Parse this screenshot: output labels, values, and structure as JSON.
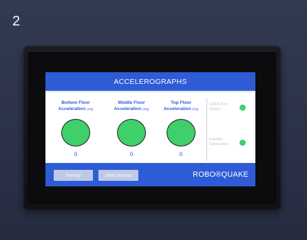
{
  "photo_label": "2",
  "header": {
    "title": "ACCELEROGRAPHS"
  },
  "sensors": [
    {
      "label_line1": "Bottom Floor",
      "label_line2": "Acceleration",
      "unit": "(mg)",
      "value": "0",
      "status_color": "#3fcf6b"
    },
    {
      "label_line1": "Middle Floor",
      "label_line2": "Acceleration",
      "unit": "(mg)",
      "value": "0",
      "status_color": "#3fcf6b"
    },
    {
      "label_line1": "Top Floor",
      "label_line2": "Acceleration",
      "unit": "(mg)",
      "value": "0",
      "status_color": "#3fcf6b"
    }
  ],
  "status": [
    {
      "label_line1": "FDAS Port",
      "label_line2": "Status",
      "indicator_color": "#3fcf6b"
    },
    {
      "label_line1": "Internet",
      "label_line2": "Connection",
      "indicator_color": "#3fcf6b"
    }
  ],
  "footer": {
    "settings_label": "Settings",
    "other_devices_label": "Other Devices",
    "brand": "ROBO®QUAKE"
  },
  "colors": {
    "accent": "#2e5bd6",
    "ok": "#3fcf6b",
    "button": "#bfc9e6"
  }
}
